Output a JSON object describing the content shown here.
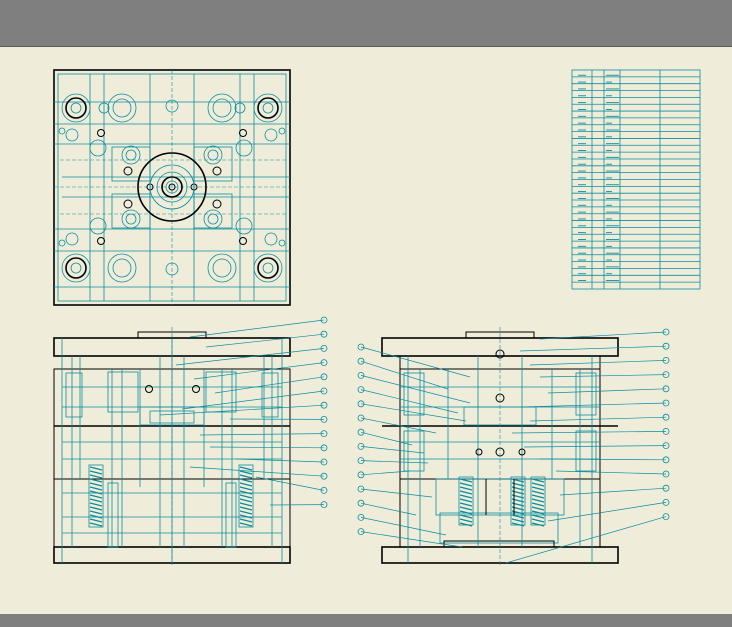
{
  "colors": {
    "background": "#efedda",
    "toolbar": "#7f7f7f",
    "line": "#0a8d9e",
    "outline": "#000000"
  },
  "views": [
    {
      "name": "top-plan-view",
      "type": "plan"
    },
    {
      "name": "front-section-view",
      "type": "section",
      "callouts": 14
    },
    {
      "name": "side-section-view",
      "type": "section",
      "callouts": 28
    }
  ],
  "bom_table": {
    "rows": 32,
    "columns": 5
  }
}
